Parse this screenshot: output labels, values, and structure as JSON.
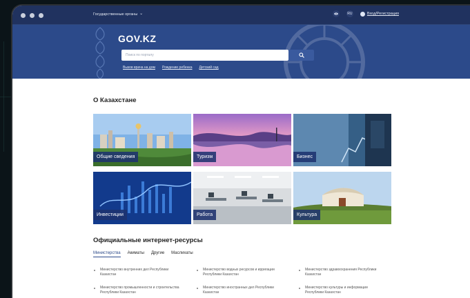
{
  "topbar": {
    "gov_orgs": "Государственные органы",
    "lang": "RU",
    "login": "Вход/Регистрация"
  },
  "hero": {
    "logo": "GOV.KZ",
    "search_placeholder": "Поиск по порталу",
    "quick_links": [
      "Вызов врача на дом",
      "Рождение ребенка",
      "Детский сад"
    ]
  },
  "about": {
    "title": "О Казахстане",
    "tiles": [
      "Общие сведения",
      "Туризм",
      "Бизнес",
      "Инвестиции",
      "Работа",
      "Культура"
    ]
  },
  "resources": {
    "title": "Официальные интернет-ресурсы",
    "tabs": [
      "Министерства",
      "Акиматы",
      "Другие",
      "Маслихаты"
    ],
    "items": [
      "Министерство внутренних дел Республики Казахстан",
      "Министерство водных ресурсов и ирригации Республики Казахстан",
      "Министерство здравоохранения Республики Казахстан",
      "Министерство промышленности и строительства Республики Казахстан",
      "Министерство иностранных дел Республики Казахстан",
      "Министерство культуры и информации Республики Казахстан"
    ]
  },
  "colors": {
    "brand": "#2c4a8a",
    "topbar": "#20325f"
  }
}
